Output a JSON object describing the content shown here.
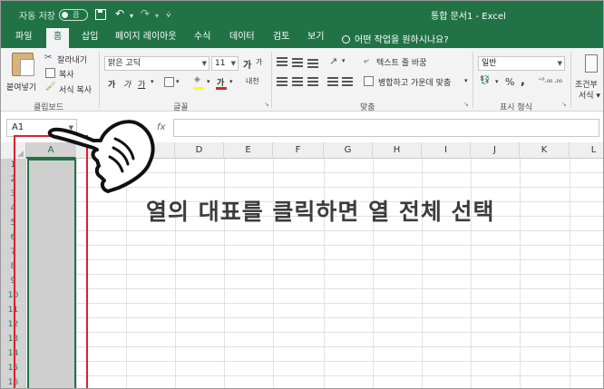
{
  "titlebar": {
    "autosave_label": "자동 저장",
    "autosave_state": "끔",
    "doc_title": "통합 문서1  -  Excel"
  },
  "tabs": {
    "file": "파일",
    "home": "홈",
    "insert": "삽입",
    "page_layout": "페이지 레이아웃",
    "formulas": "수식",
    "data": "데이터",
    "review": "검토",
    "view": "보기",
    "tell_me": "어떤 작업을 원하시나요?"
  },
  "ribbon": {
    "clipboard": {
      "paste": "붙여넣기",
      "cut": "잘라내기",
      "copy": "복사",
      "format_painter": "서식 복사",
      "group": "클립보드"
    },
    "font": {
      "font_name": "맑은 고딕",
      "font_size": "11",
      "bold": "가",
      "italic": "가",
      "underline": "가",
      "phonetic": "내천",
      "group": "글꼴"
    },
    "alignment": {
      "wrap_text": "텍스트 줄 바꿈",
      "merge_center": "병합하고 가운데 맞춤",
      "group": "맞춤"
    },
    "number": {
      "format": "일반",
      "percent": "%",
      "comma": ",",
      "group": "표시 형식"
    },
    "styles": {
      "conditional": "조건부",
      "conditional2": "서식 ▾"
    }
  },
  "formula_bar": {
    "name_box": "A1",
    "cancel": "✕",
    "enter": "✓",
    "fx": "fx"
  },
  "grid": {
    "columns": [
      "A",
      "B",
      "C",
      "D",
      "E",
      "F",
      "G",
      "H",
      "I",
      "J",
      "K",
      "L"
    ],
    "rows": [
      "1",
      "2",
      "3",
      "4",
      "5",
      "6",
      "7",
      "8",
      "9",
      "10",
      "11",
      "12",
      "13",
      "14",
      "15",
      "16"
    ],
    "selected_column": "A"
  },
  "annotation": {
    "caption": "열의 대표를 클릭하면 열 전체 선택"
  },
  "colors": {
    "excel_green": "#217346",
    "highlight_red": "#e0202a",
    "selection_gray": "#cfcfcf"
  }
}
